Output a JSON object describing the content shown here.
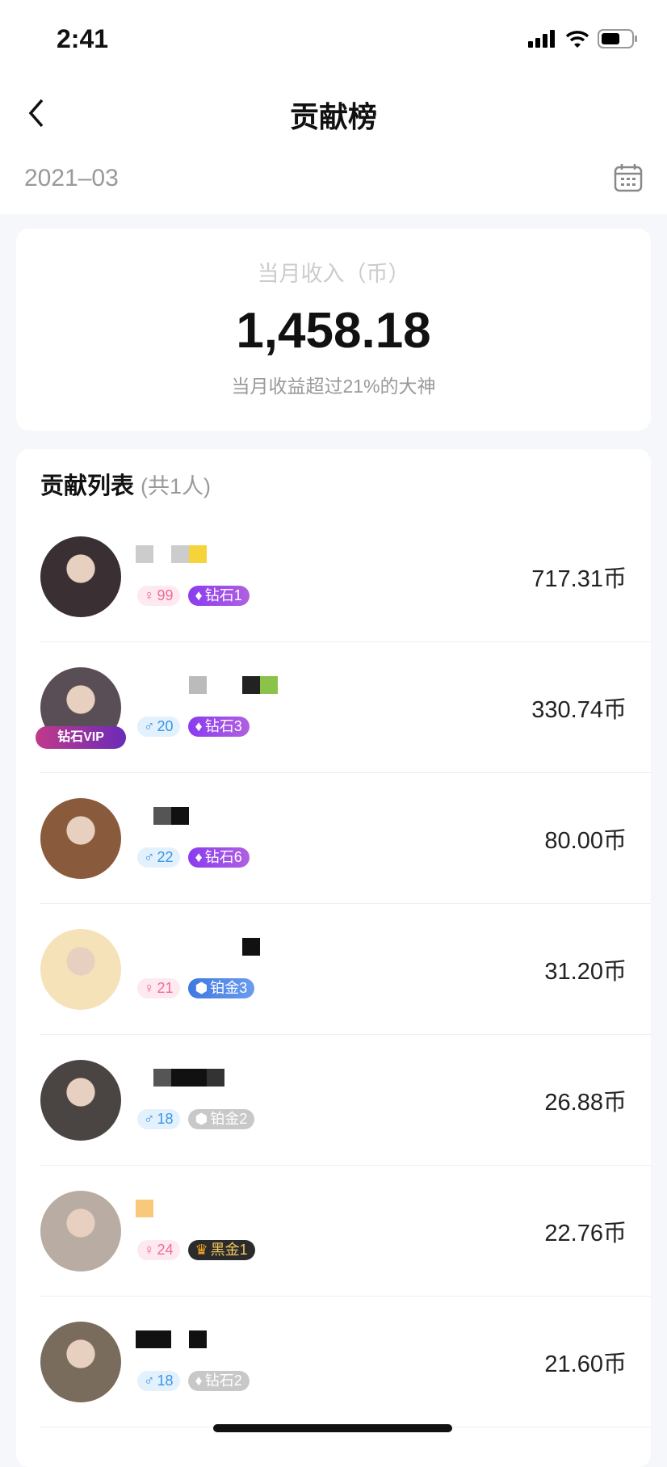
{
  "status_bar": {
    "time": "2:41"
  },
  "nav": {
    "title": "贡献榜"
  },
  "date": {
    "value": "2021–03"
  },
  "income": {
    "label": "当月收入（币）",
    "value": "1,458.18",
    "subtitle": "当月收益超过21%的大神"
  },
  "list": {
    "title": "贡献列表",
    "count": "(共1人)",
    "items": [
      {
        "gender": "female",
        "age": "99",
        "level": "钻石1",
        "level_style": "diamond",
        "amount": "717.31币",
        "avatar_color": "#3a3033"
      },
      {
        "gender": "male",
        "age": "20",
        "level": "钻石3",
        "level_style": "diamond",
        "amount": "330.74币",
        "avatar_color": "#5a4e56",
        "frame": "钻石VIP"
      },
      {
        "gender": "male",
        "age": "22",
        "level": "钻石6",
        "level_style": "diamond",
        "amount": "80.00币",
        "avatar_color": "#8a5a3c"
      },
      {
        "gender": "female",
        "age": "21",
        "level": "铂金3",
        "level_style": "platinum",
        "amount": "31.20币",
        "avatar_color": "#f5e2b8"
      },
      {
        "gender": "male",
        "age": "18",
        "level": "铂金2",
        "level_style": "gray",
        "amount": "26.88币",
        "avatar_color": "#4a4442"
      },
      {
        "gender": "female",
        "age": "24",
        "level": "黑金1",
        "level_style": "black",
        "amount": "22.76币",
        "avatar_color": "#b9aca2"
      },
      {
        "gender": "male",
        "age": "18",
        "level": "钻石2",
        "level_style": "gray",
        "amount": "21.60币",
        "avatar_color": "#7a6c5c"
      }
    ]
  },
  "colors": {
    "diamond": "#8b48e8",
    "platinum": "#4e86e6",
    "gray": "#c4c4c4",
    "black": "#2b2b2b"
  }
}
